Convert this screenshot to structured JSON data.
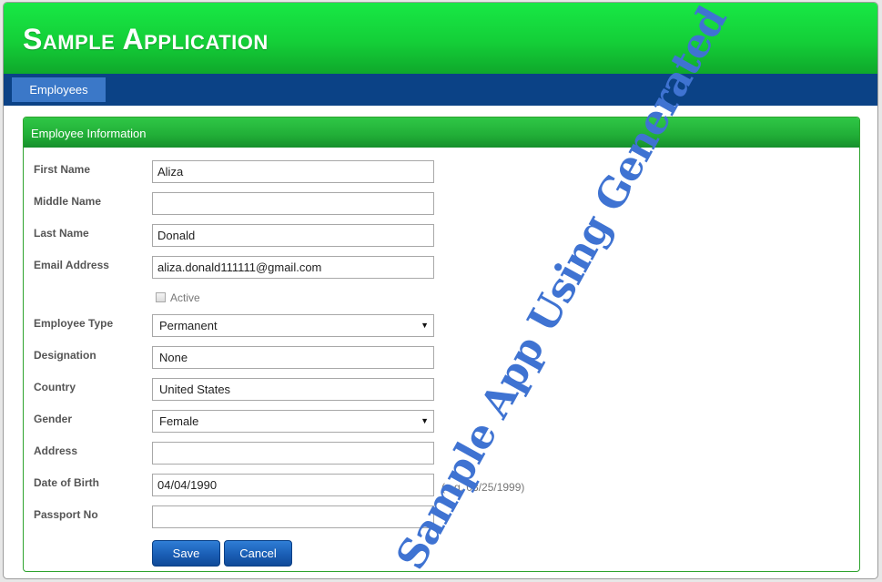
{
  "app": {
    "title": "Sample Application"
  },
  "nav": {
    "tabs": [
      {
        "label": "Employees",
        "active": true
      }
    ]
  },
  "panel": {
    "title": "Employee Information"
  },
  "form": {
    "first_name": {
      "label": "First Name",
      "value": "Aliza"
    },
    "middle_name": {
      "label": "Middle Name",
      "value": ""
    },
    "last_name": {
      "label": "Last Name",
      "value": "Donald"
    },
    "email": {
      "label": "Email Address",
      "value": "aliza.donald111111@gmail.com"
    },
    "active": {
      "label": "Active",
      "checked": false
    },
    "employee_type": {
      "label": "Employee Type",
      "selected": "Permanent"
    },
    "designation": {
      "label": "Designation",
      "value": "None"
    },
    "country": {
      "label": "Country",
      "value": "United States"
    },
    "gender": {
      "label": "Gender",
      "selected": "Female"
    },
    "address": {
      "label": "Address",
      "value": ""
    },
    "date_of_birth": {
      "label": "Date of Birth",
      "value": "04/04/1990",
      "hint": "(e.g. 03/25/1999)"
    },
    "passport_no": {
      "label": "Passport No",
      "value": ""
    }
  },
  "buttons": {
    "save": "Save",
    "cancel": "Cancel"
  },
  "watermark": {
    "text": "Sample App Using Generated Code"
  },
  "colors": {
    "header_green": "#14cf38",
    "nav_blue": "#0b4286",
    "nav_tab_active": "#3b78c8",
    "panel_border": "#2ea32e",
    "button_blue": "#1a5eb5",
    "watermark": "#3f73d2"
  },
  "icons": {
    "dropdown": "chevron-down-icon"
  }
}
